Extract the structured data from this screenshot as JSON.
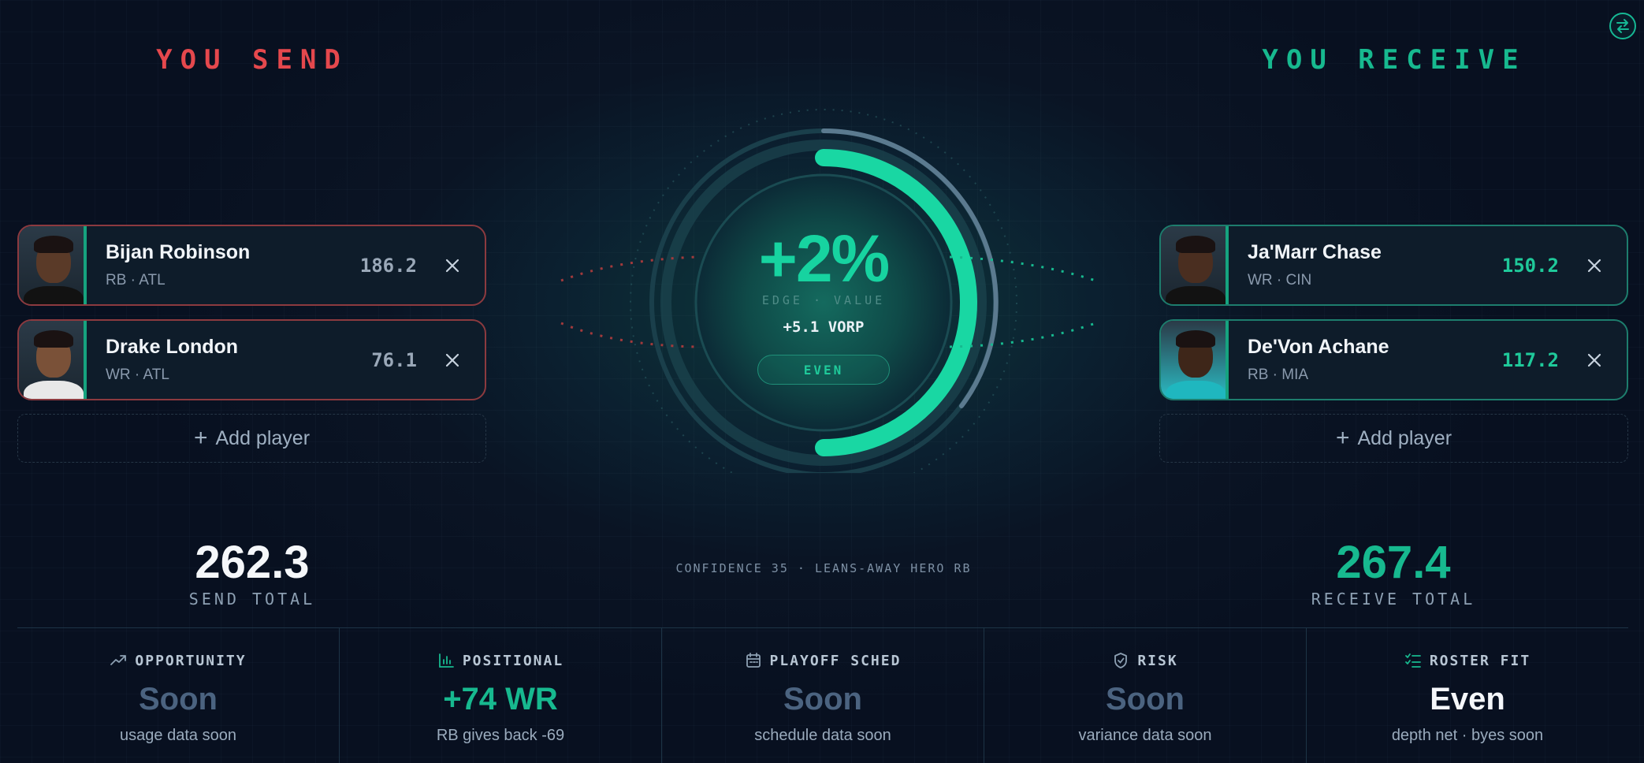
{
  "send": {
    "title": "YOU SEND",
    "players": [
      {
        "name": "Bijan Robinson",
        "meta": "RB · ATL",
        "points": "186.2"
      },
      {
        "name": "Drake London",
        "meta": "WR · ATL",
        "points": "76.1"
      }
    ],
    "add_label": "Add player",
    "total": "262.3",
    "total_label": "SEND TOTAL"
  },
  "receive": {
    "title": "YOU RECEIVE",
    "players": [
      {
        "name": "Ja'Marr Chase",
        "meta": "WR · CIN",
        "points": "150.2"
      },
      {
        "name": "De'Von Achane",
        "meta": "RB · MIA",
        "points": "117.2"
      }
    ],
    "add_label": "Add player",
    "total": "267.4",
    "total_label": "RECEIVE TOTAL"
  },
  "edge": {
    "percent": "+2%",
    "label": "EDGE · VALUE",
    "vorp": "+5.1 VORP",
    "verdict": "EVEN",
    "gauge_fraction": 0.5
  },
  "confidence": "CONFIDENCE 35 · LEANS-AWAY HERO RB",
  "metrics": [
    {
      "icon": "trend-up-icon",
      "title": "OPPORTUNITY",
      "value": "Soon",
      "sub": "usage data soon",
      "color": "#4b6380"
    },
    {
      "icon": "bar-chart-icon",
      "title": "POSITIONAL",
      "value": "+74 WR",
      "sub": "RB gives back -69",
      "color": "#17b98f"
    },
    {
      "icon": "calendar-icon",
      "title": "PLAYOFF SCHED",
      "value": "Soon",
      "sub": "schedule data soon",
      "color": "#4b6380"
    },
    {
      "icon": "shield-icon",
      "title": "RISK",
      "value": "Soon",
      "sub": "variance data soon",
      "color": "#4b6380"
    },
    {
      "icon": "checklist-icon",
      "title": "ROSTER FIT",
      "value": "Even",
      "sub": "depth net · byes soon",
      "color": "#f5f7fa"
    }
  ],
  "colors": {
    "send": "#e5484d",
    "receive": "#17b98f",
    "accent": "#17d3a0"
  },
  "icons": {
    "swap": "swap-arrows-icon",
    "remove": "close-icon",
    "add": "plus-icon"
  }
}
